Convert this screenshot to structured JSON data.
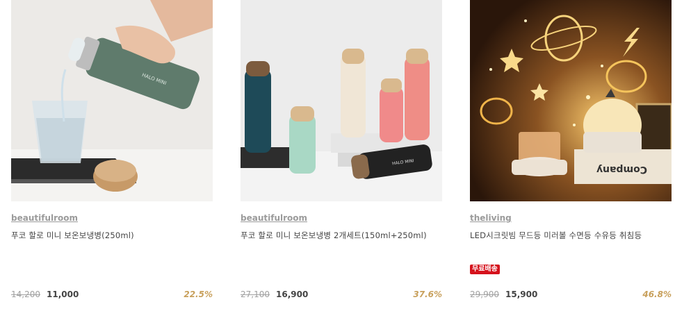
{
  "products": [
    {
      "image_icon": "thermos-pouring-image",
      "brand": "beautifulroom",
      "title": "푸코 할로 미니 보온보냉병(250ml)",
      "badge": "",
      "original_price": "14,200",
      "sale_price": "11,000",
      "discount": "22.5%"
    },
    {
      "image_icon": "thermos-set-image",
      "brand": "beautifulroom",
      "title": "푸코 할로 미니 보온보냉병 2개세트(150ml+250ml)",
      "badge": "",
      "original_price": "27,100",
      "sale_price": "16,900",
      "discount": "37.6%"
    },
    {
      "image_icon": "star-projector-image",
      "brand": "theliving",
      "title": "LED시크릿빔 무드등 미러볼 수면등 수유등 취침등",
      "badge": "무료배송",
      "original_price": "29,900",
      "sale_price": "15,900",
      "discount": "46.8%"
    }
  ],
  "colors": {
    "brand_text": "#9b9b9b",
    "discount": "#c8a05c",
    "badge_bg": "#d5121c",
    "original_price": "#a0a0a0"
  }
}
